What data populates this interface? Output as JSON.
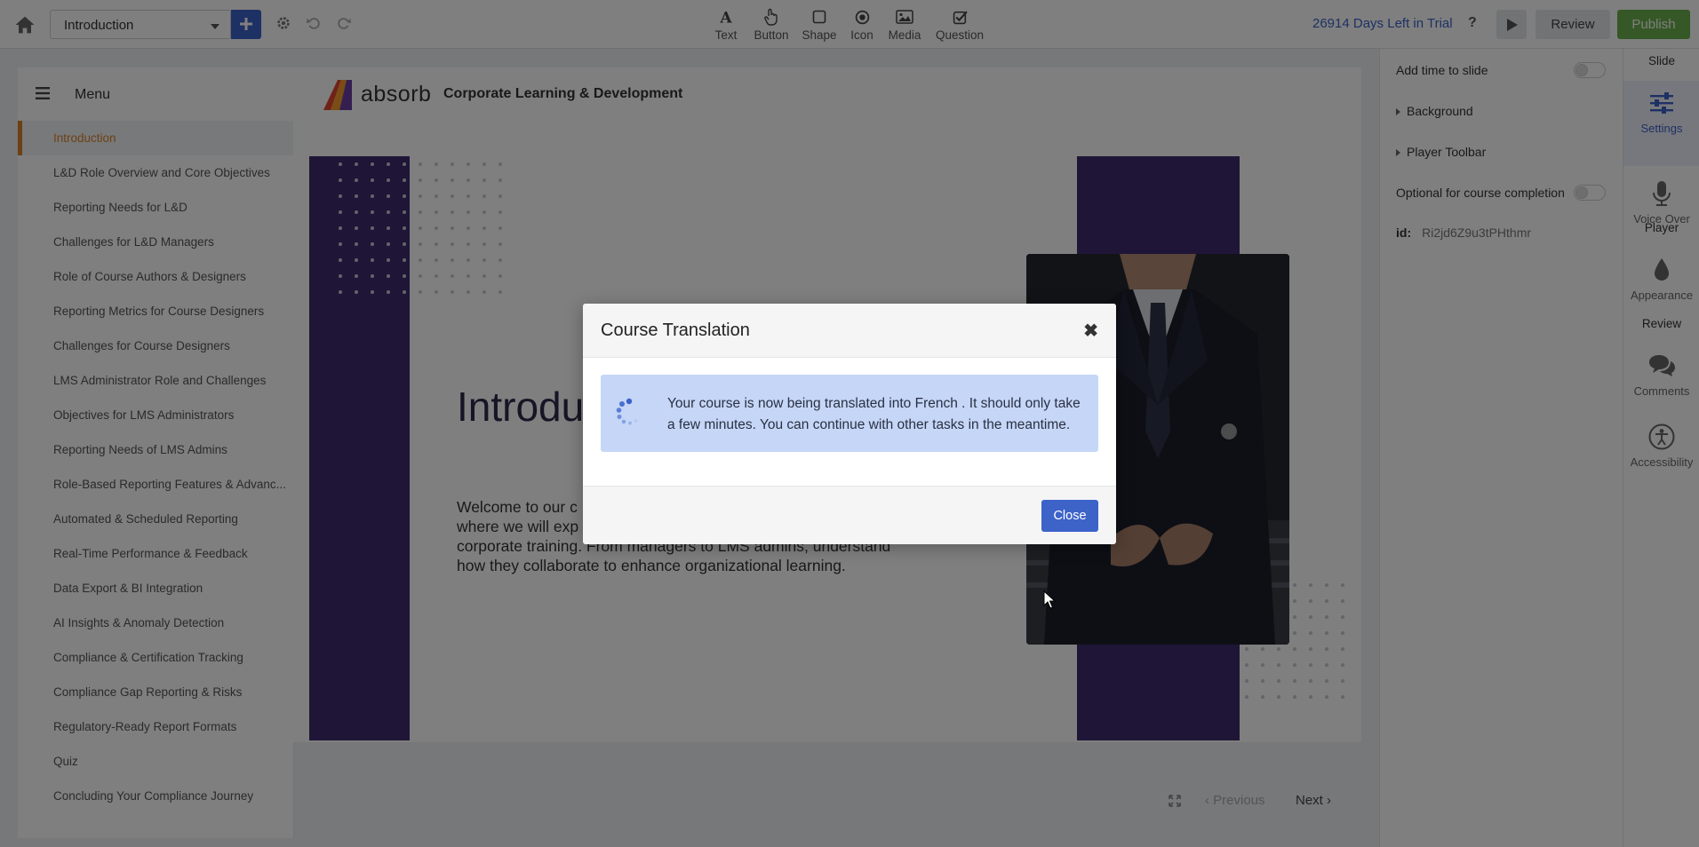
{
  "toolbar": {
    "slide_select_value": "Introduction",
    "tools": [
      {
        "label": "Text",
        "icon": "text-icon"
      },
      {
        "label": "Button",
        "icon": "hand-pointer-icon"
      },
      {
        "label": "Shape",
        "icon": "square-icon"
      },
      {
        "label": "Icon",
        "icon": "circle-dot-icon"
      },
      {
        "label": "Media",
        "icon": "image-icon"
      },
      {
        "label": "Question",
        "icon": "check-square-icon"
      }
    ],
    "trial_text": "26914 Days Left in Trial",
    "help_label": "?",
    "review_label": "Review",
    "publish_label": "Publish"
  },
  "menu": {
    "title": "Menu",
    "items": [
      "Introduction",
      "L&D Role Overview and Core Objectives",
      "Reporting Needs for L&D",
      "Challenges for L&D Managers",
      "Role of Course Authors & Designers",
      "Reporting Metrics for Course Designers",
      "Challenges for Course Designers",
      "LMS Administrator Role and Challenges",
      "Objectives for LMS Administrators",
      "Reporting Needs of LMS Admins",
      "Role-Based Reporting Features & Advanc...",
      "Automated & Scheduled Reporting",
      "Real-Time Performance & Feedback",
      "Data Export & BI Integration",
      "AI Insights & Anomaly Detection",
      "Compliance & Certification Tracking",
      "Compliance Gap Reporting & Risks",
      "Regulatory-Ready Report Formats",
      "Quiz",
      "Concluding Your Compliance Journey"
    ],
    "active_index": 0
  },
  "slide": {
    "wordmark": "absorb",
    "header_title": "Corporate Learning & Development",
    "heading_visible": "Introdu",
    "body_lines": [
      "Welcome to our c",
      "where we will exp",
      "corporate training. From managers to LMS admins, understand",
      "how they collaborate to enhance organizational learning."
    ]
  },
  "nav": {
    "previous_label": "Previous",
    "next_label": "Next"
  },
  "settings": {
    "add_time_label": "Add time to slide",
    "background_label": "Background",
    "player_toolbar_label": "Player Toolbar",
    "optional_label": "Optional for course completion",
    "id_label": "id:",
    "id_value": "Ri2jd6Z9u3tPHthmr"
  },
  "right_sidebar": {
    "slide_head": "Slide",
    "settings_label": "Settings",
    "voiceover_label": "Voice Over",
    "player_head": "Player",
    "appearance_label": "Appearance",
    "review_head": "Review",
    "comments_label": "Comments",
    "accessibility_label": "Accessibility"
  },
  "modal": {
    "title": "Course Translation",
    "close_x": "✖",
    "message": "Your course is now being translated into French . It should only take a few minutes. You can continue with other tasks in the meantime.",
    "close_button": "Close"
  },
  "colors": {
    "accent": "#3d63c9",
    "publish": "#6ab04c",
    "active_menu": "#d9822b",
    "slide_purple": "#3f2c6e",
    "alert_bg": "#c5d6f7"
  }
}
